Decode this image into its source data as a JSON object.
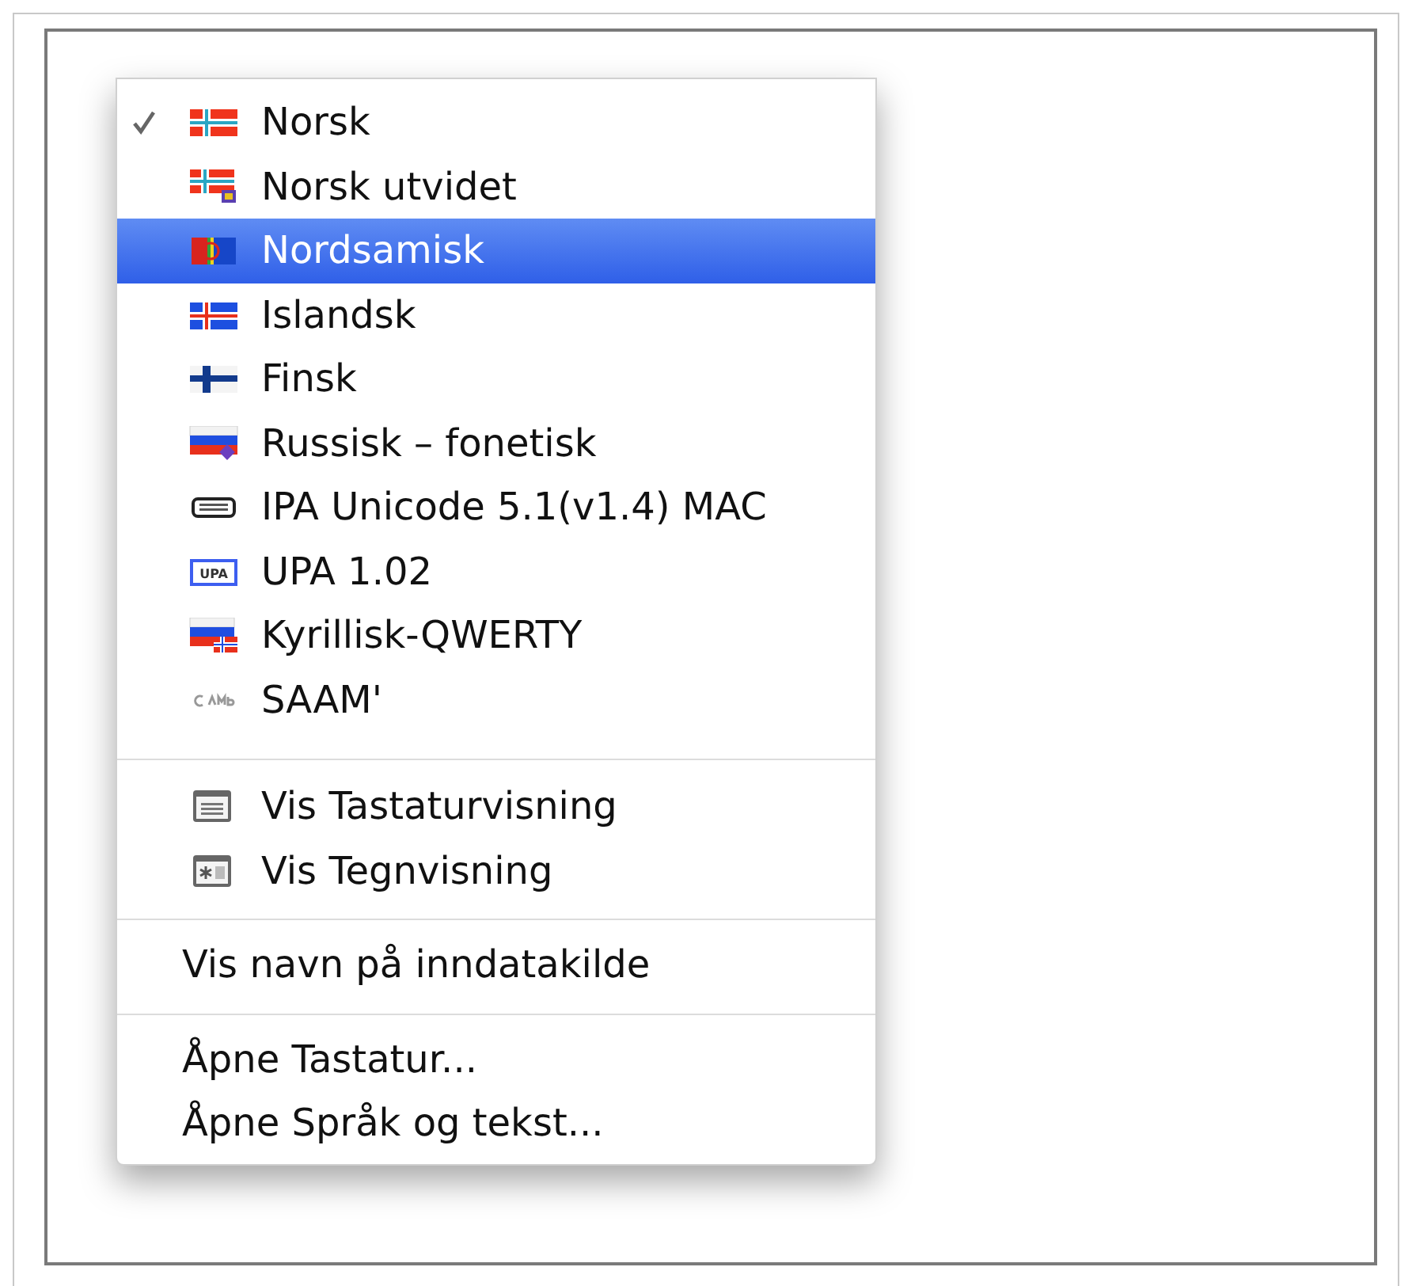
{
  "menu": {
    "sections": [
      {
        "items": [
          {
            "label": "Norsk",
            "kind": "flag-norway",
            "checked": true,
            "selected": false
          },
          {
            "label": "Norsk utvidet",
            "kind": "flag-norway-u",
            "checked": false,
            "selected": false
          },
          {
            "label": "Nordsamisk",
            "kind": "flag-sami",
            "checked": false,
            "selected": true
          },
          {
            "label": "Islandsk",
            "kind": "flag-iceland",
            "checked": false,
            "selected": false
          },
          {
            "label": "Finsk",
            "kind": "flag-finland",
            "checked": false,
            "selected": false
          },
          {
            "label": "Russisk – fonetisk",
            "kind": "flag-russia-diamond",
            "checked": false,
            "selected": false
          },
          {
            "label": "IPA Unicode 5.1(v1.4) MAC",
            "kind": "keyboard",
            "checked": false,
            "selected": false
          },
          {
            "label": "UPA 1.02",
            "kind": "upa",
            "icon_text": "UPA",
            "checked": false,
            "selected": false
          },
          {
            "label": "Kyrillisk-QWERTY",
            "kind": "flag-russia-norway",
            "checked": false,
            "selected": false
          },
          {
            "label": "SAAM'",
            "kind": "glyph",
            "checked": false,
            "selected": false
          }
        ]
      },
      {
        "items": [
          {
            "label": "Vis Tastaturvisning",
            "kind": "keyboard-window",
            "checked": false,
            "selected": false
          },
          {
            "label": "Vis Tegnvisning",
            "kind": "character-window",
            "checked": false,
            "selected": false
          }
        ]
      },
      {
        "items": [
          {
            "label": "Vis navn på inndatakilde",
            "checked": false,
            "selected": false
          }
        ]
      },
      {
        "items": [
          {
            "label": "Åpne Tastatur...",
            "checked": false,
            "selected": false
          },
          {
            "label": "Åpne Språk og tekst...",
            "checked": false,
            "selected": false
          }
        ]
      }
    ]
  }
}
